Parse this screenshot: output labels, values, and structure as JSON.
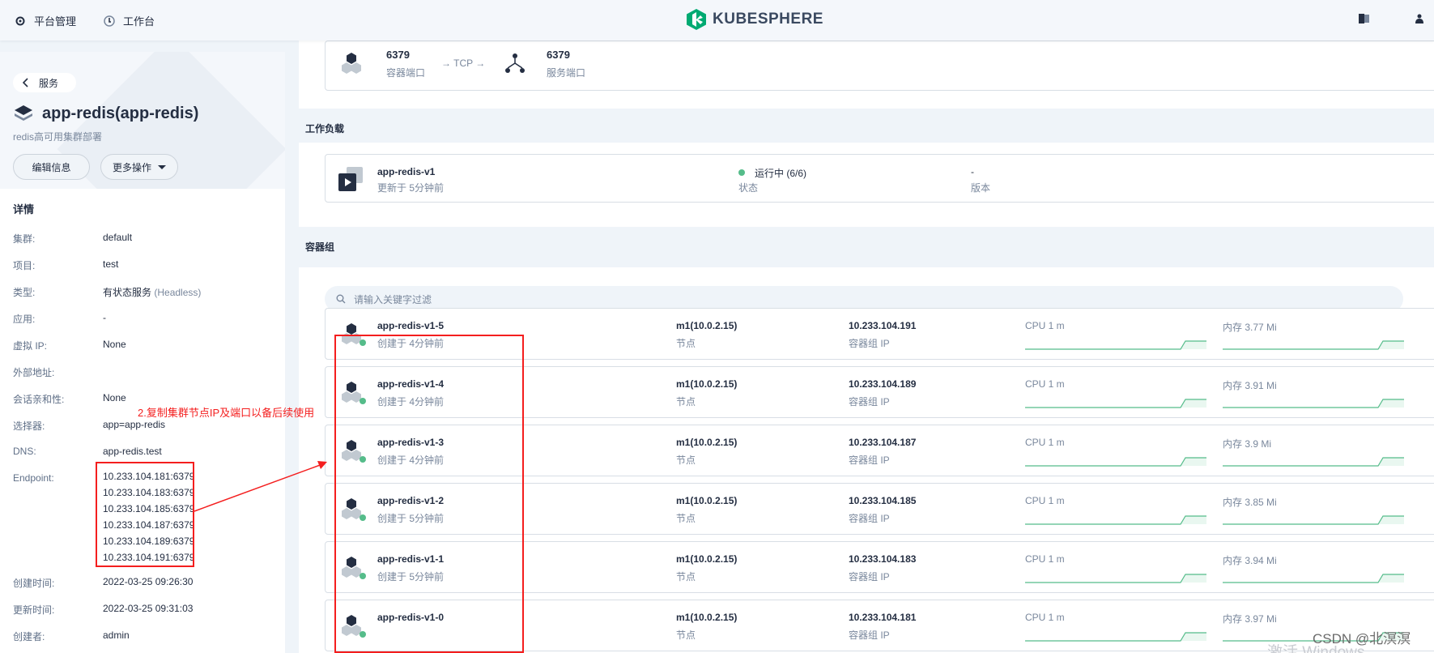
{
  "topbar": {
    "platform_label": "平台管理",
    "workbench_label": "工作台",
    "brand": "KUBESPHERE"
  },
  "left": {
    "back_label": "服务",
    "service_name": "app-redis(app-redis)",
    "service_desc": "redis高可用集群部署",
    "edit_label": "编辑信息",
    "more_label": "更多操作",
    "details_title": "详情",
    "details": [
      {
        "key": "集群:",
        "value": "default"
      },
      {
        "key": "项目:",
        "value": "test"
      },
      {
        "key": "类型:",
        "value": "有状态服务",
        "extra": "(Headless)"
      },
      {
        "key": "应用:",
        "value": "-"
      },
      {
        "key": "虚拟 IP:",
        "value": "None"
      },
      {
        "key": "外部地址:",
        "value": ""
      },
      {
        "key": "会话亲和性:",
        "value": "None"
      },
      {
        "key": "选择器:",
        "value": "app=app-redis"
      },
      {
        "key": "DNS:",
        "value": "app-redis.test"
      },
      {
        "key": "Endpoint:",
        "value": ""
      },
      {
        "key": "创建时间:",
        "value": "2022-03-25 09:26:30"
      },
      {
        "key": "更新时间:",
        "value": "2022-03-25 09:31:03"
      },
      {
        "key": "创建者:",
        "value": "admin"
      }
    ],
    "endpoints": [
      "10.233.104.181:6379",
      "10.233.104.183:6379",
      "10.233.104.185:6379",
      "10.233.104.187:6379",
      "10.233.104.189:6379",
      "10.233.104.191:6379"
    ]
  },
  "ports": {
    "container_port": "6379",
    "container_port_label": "容器端口",
    "protocol": "→ TCP →",
    "service_port": "6379",
    "service_port_label": "服务端口"
  },
  "workload": {
    "section_title": "工作负载",
    "name": "app-redis-v1",
    "updated": "更新于 5分钟前",
    "status": "运行中 (6/6)",
    "status_label": "状态",
    "version": "-",
    "version_label": "版本"
  },
  "pods": {
    "section_title": "容器组",
    "search_placeholder": "请输入关键字过滤",
    "node_label": "节点",
    "ip_label": "容器组 IP",
    "items": [
      {
        "name": "app-redis-v1-5",
        "created": "创建于 4分钟前",
        "node": "m1(10.0.2.15)",
        "ip": "10.233.104.191",
        "cpu": "CPU 1 m",
        "mem": "内存 3.77 Mi"
      },
      {
        "name": "app-redis-v1-4",
        "created": "创建于 4分钟前",
        "node": "m1(10.0.2.15)",
        "ip": "10.233.104.189",
        "cpu": "CPU 1 m",
        "mem": "内存 3.91 Mi"
      },
      {
        "name": "app-redis-v1-3",
        "created": "创建于 4分钟前",
        "node": "m1(10.0.2.15)",
        "ip": "10.233.104.187",
        "cpu": "CPU 1 m",
        "mem": "内存 3.9 Mi"
      },
      {
        "name": "app-redis-v1-2",
        "created": "创建于 5分钟前",
        "node": "m1(10.0.2.15)",
        "ip": "10.233.104.185",
        "cpu": "CPU 1 m",
        "mem": "内存 3.85 Mi"
      },
      {
        "name": "app-redis-v1-1",
        "created": "创建于 5分钟前",
        "node": "m1(10.0.2.15)",
        "ip": "10.233.104.183",
        "cpu": "CPU 1 m",
        "mem": "内存 3.94 Mi"
      },
      {
        "name": "app-redis-v1-0",
        "created": "",
        "node": "m1(10.0.2.15)",
        "ip": "10.233.104.181",
        "cpu": "CPU 1 m",
        "mem": "内存 3.97 Mi"
      }
    ]
  },
  "annotation": "2.复制集群节点IP及端口以备后续使用",
  "watermark": "CSDN @北溟溟",
  "windows_watermark": "激活 Windows",
  "colors": {
    "annotation_red": "#f41e1e",
    "status_green": "#55bc8a",
    "brand_green": "#00aa72"
  }
}
